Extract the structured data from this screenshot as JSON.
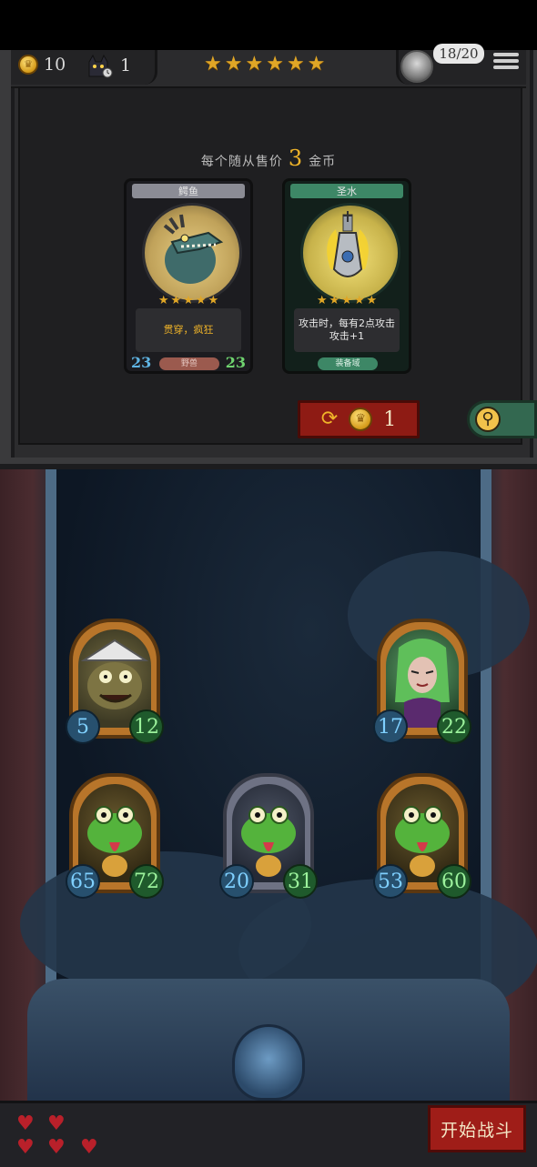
{
  "topbar": {
    "gold": "10",
    "cats": "1",
    "tier_stars": [
      "★",
      "★",
      "★",
      "★",
      "★",
      "★"
    ],
    "population": "18/20",
    "icons": {
      "gold": "gold-crown-coin-icon",
      "cat": "cat-clock-icon",
      "menu": "hamburger-menu-icon",
      "avatar": "player-avatar-icon"
    }
  },
  "shop": {
    "price_prefix": "每个随从售价",
    "price_value": "3",
    "price_suffix": "金币",
    "cards": [
      {
        "name": "鳄鱼",
        "stars": 5,
        "description": "贯穿，疯狂",
        "tag": "野兽",
        "attack": "23",
        "health": "23"
      },
      {
        "name": "圣水",
        "stars": 5,
        "description": "攻击时，每有2点攻击攻击+1",
        "tag": "装备域",
        "attack": "",
        "health": ""
      }
    ],
    "refresh_cost": "1"
  },
  "board": {
    "units": [
      {
        "id": "toad-shaman",
        "attack": "5",
        "health": "12",
        "frame": "gold"
      },
      {
        "id": "medusa",
        "attack": "17",
        "health": "22",
        "frame": "gold"
      },
      {
        "id": "frog-left",
        "attack": "65",
        "health": "72",
        "frame": "gold"
      },
      {
        "id": "frog-middle",
        "attack": "20",
        "health": "31",
        "frame": "silver"
      },
      {
        "id": "frog-right",
        "attack": "53",
        "health": "60",
        "frame": "gold"
      }
    ]
  },
  "bottom": {
    "lives": 5,
    "start_label": "开始战斗"
  },
  "colors": {
    "gold_accent": "#f0b429",
    "button_red": "#9f1d18",
    "attack_blue": "#7fd0ff",
    "health_green": "#9cf29c"
  }
}
